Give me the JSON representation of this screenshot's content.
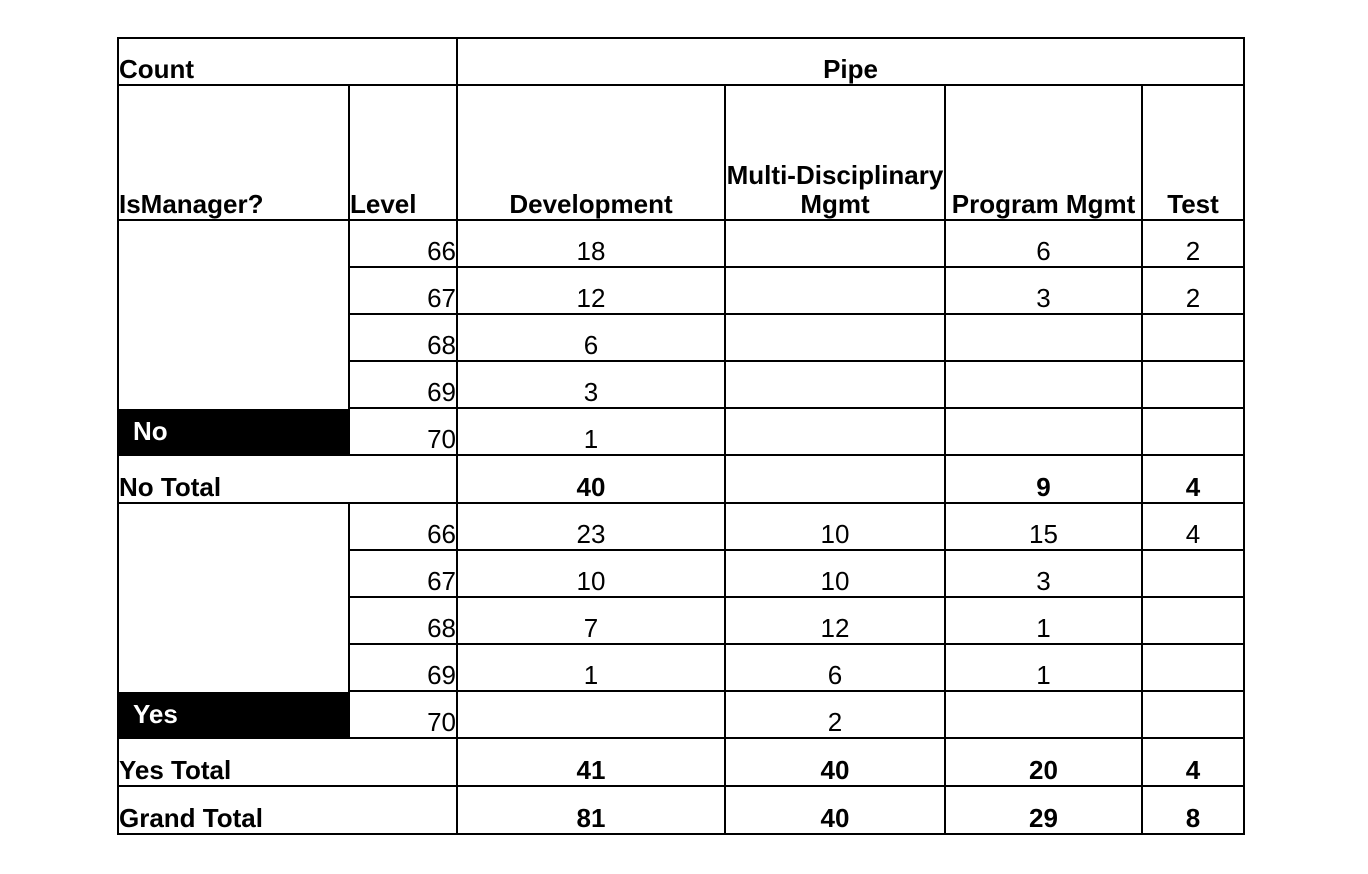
{
  "table": {
    "corner_label": "Count",
    "column_group_header": "Pipe",
    "row_field_labels": [
      "IsManager?",
      "Level"
    ],
    "value_columns": [
      "Development",
      "Multi-Disciplinary Mgmt",
      "Program Mgmt",
      "Test"
    ],
    "groups": [
      {
        "name": "No",
        "rows": [
          {
            "level": "66",
            "values": [
              "18",
              "",
              "6",
              "2"
            ]
          },
          {
            "level": "67",
            "values": [
              "12",
              "",
              "3",
              "2"
            ]
          },
          {
            "level": "68",
            "values": [
              "6",
              "",
              "",
              ""
            ]
          },
          {
            "level": "69",
            "values": [
              "3",
              "",
              "",
              ""
            ]
          },
          {
            "level": "70",
            "values": [
              "1",
              "",
              "",
              ""
            ]
          }
        ],
        "total_label": "No Total",
        "total_values": [
          "40",
          "",
          "9",
          "4"
        ]
      },
      {
        "name": "Yes",
        "rows": [
          {
            "level": "66",
            "values": [
              "23",
              "10",
              "15",
              "4"
            ]
          },
          {
            "level": "67",
            "values": [
              "10",
              "10",
              "3",
              ""
            ]
          },
          {
            "level": "68",
            "values": [
              "7",
              "12",
              "1",
              ""
            ]
          },
          {
            "level": "69",
            "values": [
              "1",
              "6",
              "1",
              ""
            ]
          },
          {
            "level": "70",
            "values": [
              "",
              "2",
              "",
              ""
            ]
          }
        ],
        "total_label": "Yes Total",
        "total_values": [
          "41",
          "40",
          "20",
          "4"
        ]
      }
    ],
    "grand_total_label": "Grand Total",
    "grand_total_values": [
      "81",
      "40",
      "29",
      "8"
    ]
  },
  "colors": {
    "header_fill": "#000000",
    "header_text": "#ffffff",
    "body_fill": "#ffffff",
    "body_text": "#000000",
    "border": "#000000"
  },
  "chart_data": {
    "type": "table",
    "title": "Count",
    "row_fields": [
      "IsManager?",
      "Level"
    ],
    "column_field": "Pipe",
    "categories": [
      "Development",
      "Multi-Disciplinary Mgmt",
      "Program Mgmt",
      "Test"
    ],
    "rows": [
      {
        "ismanager": "No",
        "level": 66,
        "Development": 18,
        "Multi-Disciplinary Mgmt": null,
        "Program Mgmt": 6,
        "Test": 2
      },
      {
        "ismanager": "No",
        "level": 67,
        "Development": 12,
        "Multi-Disciplinary Mgmt": null,
        "Program Mgmt": 3,
        "Test": 2
      },
      {
        "ismanager": "No",
        "level": 68,
        "Development": 6,
        "Multi-Disciplinary Mgmt": null,
        "Program Mgmt": null,
        "Test": null
      },
      {
        "ismanager": "No",
        "level": 69,
        "Development": 3,
        "Multi-Disciplinary Mgmt": null,
        "Program Mgmt": null,
        "Test": null
      },
      {
        "ismanager": "No",
        "level": 70,
        "Development": 1,
        "Multi-Disciplinary Mgmt": null,
        "Program Mgmt": null,
        "Test": null
      },
      {
        "ismanager": "No Total",
        "level": null,
        "Development": 40,
        "Multi-Disciplinary Mgmt": null,
        "Program Mgmt": 9,
        "Test": 4
      },
      {
        "ismanager": "Yes",
        "level": 66,
        "Development": 23,
        "Multi-Disciplinary Mgmt": 10,
        "Program Mgmt": 15,
        "Test": 4
      },
      {
        "ismanager": "Yes",
        "level": 67,
        "Development": 10,
        "Multi-Disciplinary Mgmt": 10,
        "Program Mgmt": 3,
        "Test": null
      },
      {
        "ismanager": "Yes",
        "level": 68,
        "Development": 7,
        "Multi-Disciplinary Mgmt": 12,
        "Program Mgmt": 1,
        "Test": null
      },
      {
        "ismanager": "Yes",
        "level": 69,
        "Development": 1,
        "Multi-Disciplinary Mgmt": 6,
        "Program Mgmt": 1,
        "Test": null
      },
      {
        "ismanager": "Yes",
        "level": 70,
        "Development": null,
        "Multi-Disciplinary Mgmt": 2,
        "Program Mgmt": null,
        "Test": null
      },
      {
        "ismanager": "Yes Total",
        "level": null,
        "Development": 41,
        "Multi-Disciplinary Mgmt": 40,
        "Program Mgmt": 20,
        "Test": 4
      },
      {
        "ismanager": "Grand Total",
        "level": null,
        "Development": 81,
        "Multi-Disciplinary Mgmt": 40,
        "Program Mgmt": 29,
        "Test": 8
      }
    ]
  }
}
